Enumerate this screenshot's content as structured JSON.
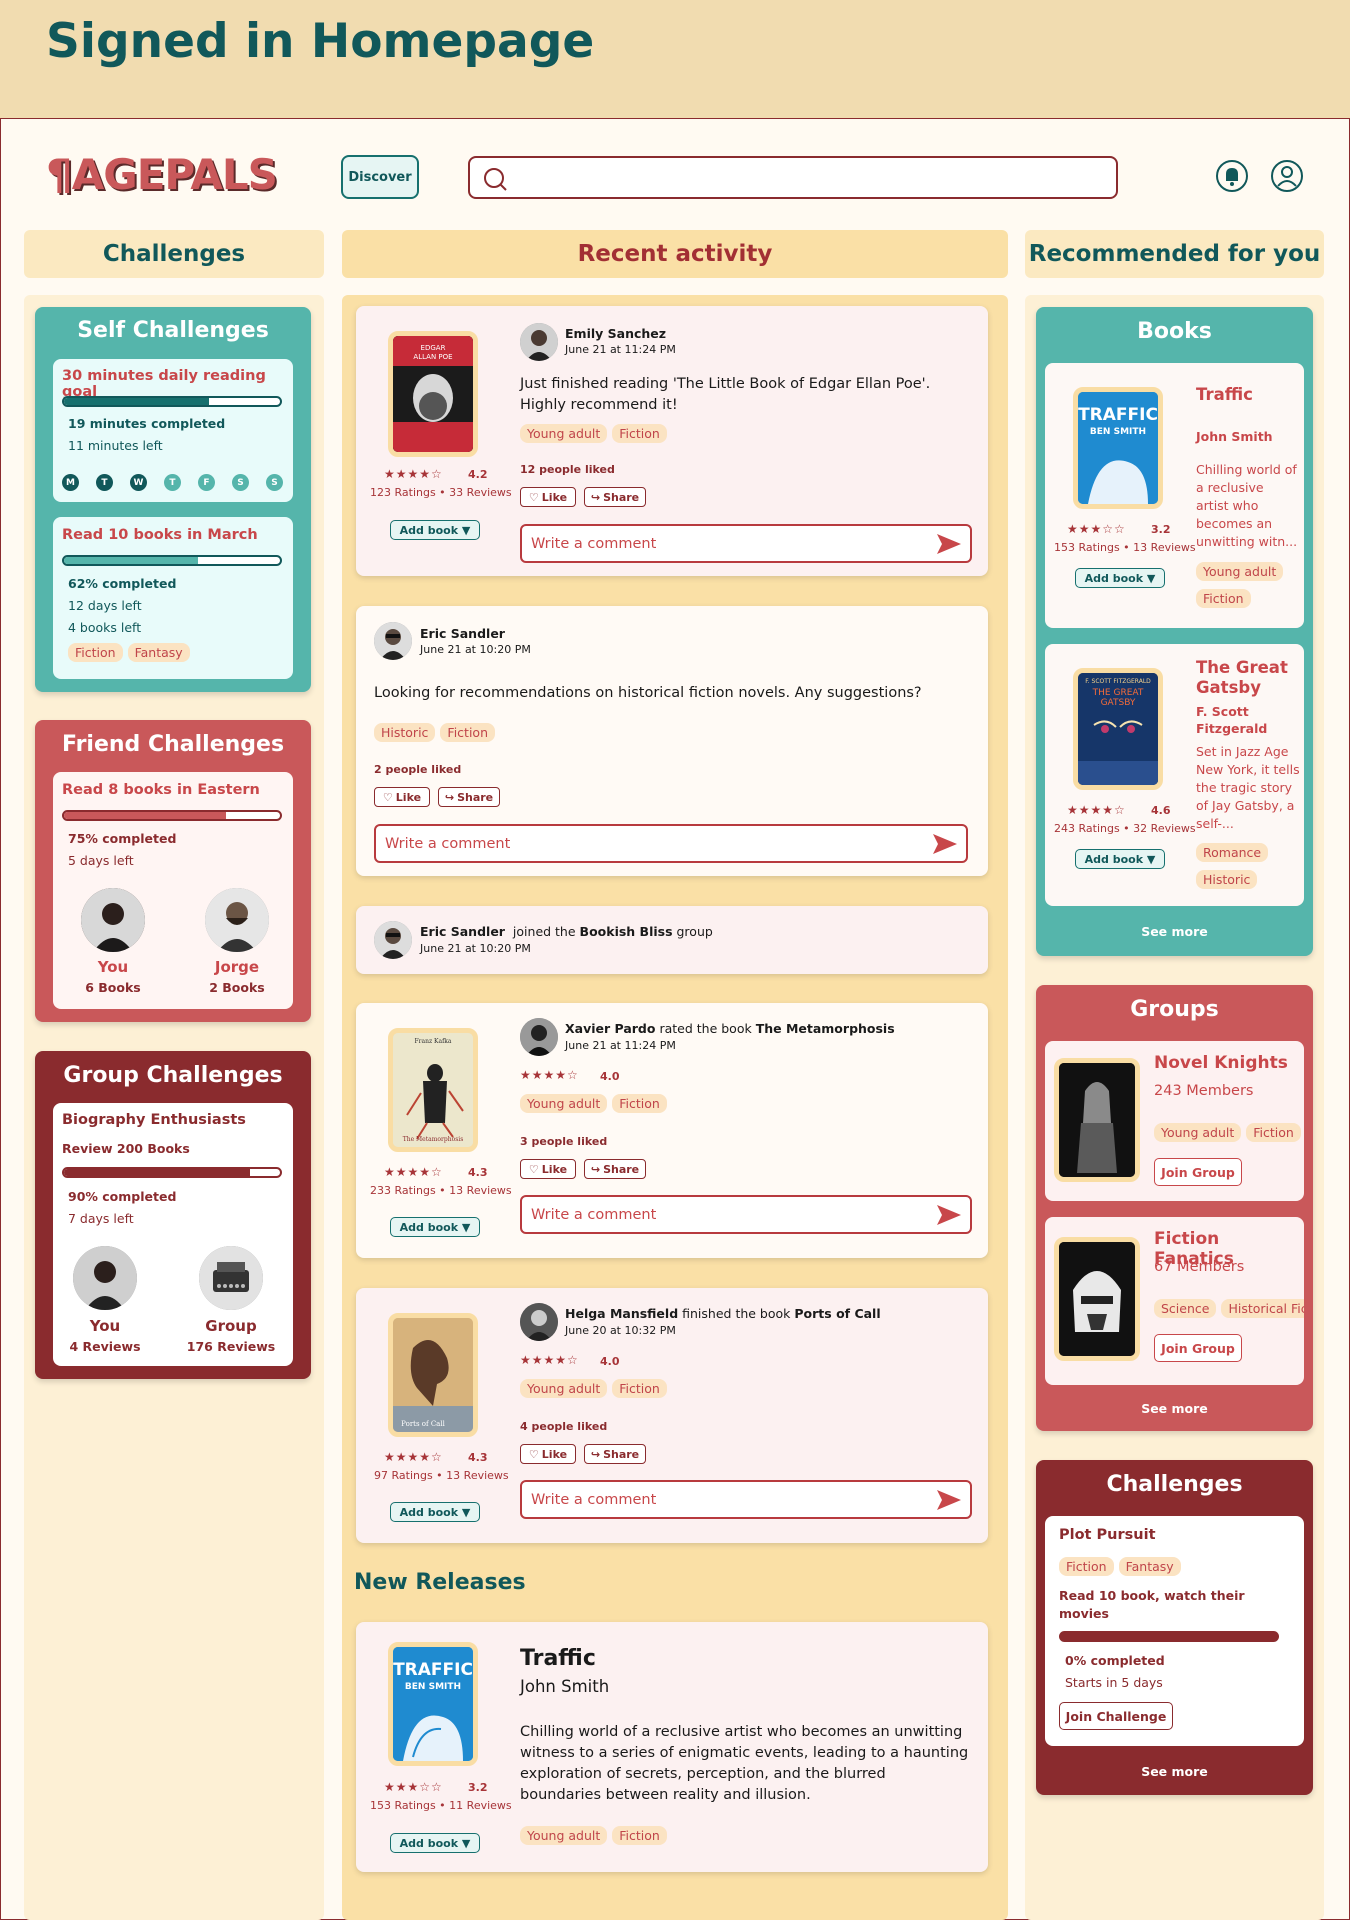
{
  "page_title": "Signed in Homepage",
  "header": {
    "logo": "¶AGEPALS",
    "discover": "Discover",
    "search_placeholder": ""
  },
  "columns": {
    "left": "Challenges",
    "center": "Recent activity",
    "right": "Recommended for you"
  },
  "colors": {
    "teal": "#55b5ab",
    "red": "#c9585a",
    "maroon": "#8a2b2e",
    "cream": "#fae8c0",
    "dark_teal": "#11585a"
  },
  "self_challenges": {
    "title": "Self Challenges",
    "c1": {
      "title": "30 minutes daily reading goal",
      "progress": 0.67,
      "completed": "19 minutes completed",
      "left": "11 minutes left",
      "days": [
        "M",
        "T",
        "W",
        "T",
        "F",
        "S",
        "S"
      ]
    },
    "c2": {
      "title": "Read 10 books in March",
      "progress": 0.62,
      "completed": "62% completed",
      "days_left": "12 days left",
      "books_left": "4 books left",
      "tags": [
        "Fiction",
        "Fantasy"
      ]
    }
  },
  "friend_challenges": {
    "title": "Friend Challenges",
    "name": "Read 8 books in Eastern",
    "progress": 0.75,
    "completed": "75% completed",
    "days_left": "5 days left",
    "p1": {
      "name": "You",
      "count": "6 Books"
    },
    "p2": {
      "name": "Jorge",
      "count": "2 Books"
    }
  },
  "group_challenges": {
    "title": "Group Challenges",
    "group": "Biography Enthusiasts",
    "goal": "Review 200 Books",
    "progress": 0.9,
    "completed": "90% completed",
    "days_left": "7 days left",
    "p1": {
      "name": "You",
      "count": "4 Reviews"
    },
    "p2": {
      "name": "Group",
      "count": "176 Reviews"
    }
  },
  "posts": [
    {
      "user": "Emily Sanchez",
      "date": "June 21 at 11:24 PM",
      "text": "Just finished reading 'The Little Book of Edgar Ellan Poe'. Highly recommend it!",
      "tags": [
        "Young adult",
        "Fiction"
      ],
      "likes": "12 people liked",
      "rating": "4.2",
      "ratings": "123 Ratings • 33 Reviews",
      "cover_top": "EDGAR ALLAN POE"
    },
    {
      "user": "Eric Sandler",
      "date": "June 21 at 10:20 PM",
      "text": "Looking for recommendations on historical fiction novels. Any suggestions?",
      "tags": [
        "Historic",
        "Fiction"
      ],
      "likes": "2 people liked"
    },
    {
      "user": "Eric Sandler",
      "joined": "joined the",
      "group": "Bookish Bliss",
      "suffix": "group",
      "date": "June 21 at 10:20 PM"
    },
    {
      "user": "Xavier Pardo",
      "action": "rated the book",
      "book": "The Metamorphosis",
      "date": "June 21 at 11:24 PM",
      "rating_small": "4.0",
      "tags": [
        "Young adult",
        "Fiction"
      ],
      "likes": "3 people liked",
      "rating": "4.3",
      "ratings": "233 Ratings • 13 Reviews",
      "cover_top": "Franz Kafka",
      "cover_bottom": "The Metamorphosis"
    },
    {
      "user": "Helga Mansfield",
      "action": "finished the book",
      "book": "Ports of Call",
      "date": "June 20 at 10:32 PM",
      "rating_small": "4.0",
      "tags": [
        "Young adult",
        "Fiction"
      ],
      "likes": "4 people liked",
      "rating": "4.3",
      "ratings": "97 Ratings • 13 Reviews",
      "cover_bottom": "Ports of Call"
    }
  ],
  "actions": {
    "like": "Like",
    "share": "Share",
    "comment": "Write a comment",
    "add_book": "Add book ▼"
  },
  "new_releases": {
    "title": "New Releases",
    "book": "Traffic",
    "author": "John Smith",
    "desc": "Chilling world of a reclusive artist who becomes an unwitting witness to a series of enigmatic events, leading to a haunting exploration of secrets, perception, and the blurred boundaries between reality and illusion.",
    "tags": [
      "Young adult",
      "Fiction"
    ],
    "rating": "3.2",
    "ratings": "153 Ratings • 11 Reviews",
    "cover_title": "TRAFFIC",
    "cover_author": "BEN SMITH"
  },
  "rec_books": {
    "title": "Books",
    "b1": {
      "title": "Traffic",
      "author": "John Smith",
      "desc": "Chilling world of a reclusive artist who becomes an unwitting witn...",
      "tags": [
        "Young adult",
        "Fiction"
      ],
      "rating": "3.2",
      "ratings": "153 Ratings • 13 Reviews",
      "cover_title": "TRAFFIC",
      "cover_author": "BEN SMITH"
    },
    "b2": {
      "title": "The Great Gatsby",
      "author": "F. Scott Fitzgerald",
      "desc": "Set in Jazz Age New York, it tells the tragic story of Jay Gatsby, a self-...",
      "tags": [
        "Romance",
        "Historic"
      ],
      "rating": "4.6",
      "ratings": "243 Ratings • 32 Reviews",
      "cover_top": "F. SCOTT FITZGERALD",
      "cover_title": "THE GREAT GATSBY"
    },
    "see_more": "See more"
  },
  "groups": {
    "title": "Groups",
    "g1": {
      "name": "Novel Knights",
      "members": "243 Members",
      "tags": [
        "Young adult",
        "Fiction"
      ],
      "join": "Join Group"
    },
    "g2": {
      "name": "Fiction Fanatics",
      "members": "67 Members",
      "tags": [
        "Science",
        "Historical Fict"
      ],
      "join": "Join Group"
    },
    "see_more": "See more"
  },
  "rec_challenges": {
    "title": "Challenges",
    "name": "Plot Pursuit",
    "tags": [
      "Fiction",
      "Fantasy"
    ],
    "goal": "Read 10 book, watch their movies",
    "completed": "0% completed",
    "starts": "Starts in 5 days",
    "join": "Join Challenge",
    "see_more": "See more"
  }
}
